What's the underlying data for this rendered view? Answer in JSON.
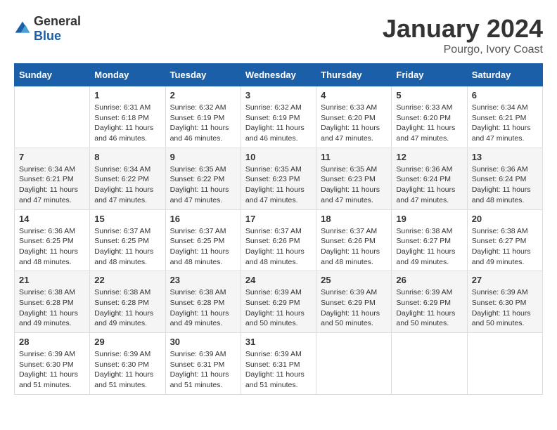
{
  "logo": {
    "general": "General",
    "blue": "Blue"
  },
  "header": {
    "month": "January 2024",
    "location": "Pourgo, Ivory Coast"
  },
  "weekdays": [
    "Sunday",
    "Monday",
    "Tuesday",
    "Wednesday",
    "Thursday",
    "Friday",
    "Saturday"
  ],
  "weeks": [
    [
      {
        "day": "",
        "info": ""
      },
      {
        "day": "1",
        "info": "Sunrise: 6:31 AM\nSunset: 6:18 PM\nDaylight: 11 hours\nand 46 minutes."
      },
      {
        "day": "2",
        "info": "Sunrise: 6:32 AM\nSunset: 6:19 PM\nDaylight: 11 hours\nand 46 minutes."
      },
      {
        "day": "3",
        "info": "Sunrise: 6:32 AM\nSunset: 6:19 PM\nDaylight: 11 hours\nand 46 minutes."
      },
      {
        "day": "4",
        "info": "Sunrise: 6:33 AM\nSunset: 6:20 PM\nDaylight: 11 hours\nand 47 minutes."
      },
      {
        "day": "5",
        "info": "Sunrise: 6:33 AM\nSunset: 6:20 PM\nDaylight: 11 hours\nand 47 minutes."
      },
      {
        "day": "6",
        "info": "Sunrise: 6:34 AM\nSunset: 6:21 PM\nDaylight: 11 hours\nand 47 minutes."
      }
    ],
    [
      {
        "day": "7",
        "info": "Sunrise: 6:34 AM\nSunset: 6:21 PM\nDaylight: 11 hours\nand 47 minutes."
      },
      {
        "day": "8",
        "info": "Sunrise: 6:34 AM\nSunset: 6:22 PM\nDaylight: 11 hours\nand 47 minutes."
      },
      {
        "day": "9",
        "info": "Sunrise: 6:35 AM\nSunset: 6:22 PM\nDaylight: 11 hours\nand 47 minutes."
      },
      {
        "day": "10",
        "info": "Sunrise: 6:35 AM\nSunset: 6:23 PM\nDaylight: 11 hours\nand 47 minutes."
      },
      {
        "day": "11",
        "info": "Sunrise: 6:35 AM\nSunset: 6:23 PM\nDaylight: 11 hours\nand 47 minutes."
      },
      {
        "day": "12",
        "info": "Sunrise: 6:36 AM\nSunset: 6:24 PM\nDaylight: 11 hours\nand 47 minutes."
      },
      {
        "day": "13",
        "info": "Sunrise: 6:36 AM\nSunset: 6:24 PM\nDaylight: 11 hours\nand 48 minutes."
      }
    ],
    [
      {
        "day": "14",
        "info": "Sunrise: 6:36 AM\nSunset: 6:25 PM\nDaylight: 11 hours\nand 48 minutes."
      },
      {
        "day": "15",
        "info": "Sunrise: 6:37 AM\nSunset: 6:25 PM\nDaylight: 11 hours\nand 48 minutes."
      },
      {
        "day": "16",
        "info": "Sunrise: 6:37 AM\nSunset: 6:25 PM\nDaylight: 11 hours\nand 48 minutes."
      },
      {
        "day": "17",
        "info": "Sunrise: 6:37 AM\nSunset: 6:26 PM\nDaylight: 11 hours\nand 48 minutes."
      },
      {
        "day": "18",
        "info": "Sunrise: 6:37 AM\nSunset: 6:26 PM\nDaylight: 11 hours\nand 48 minutes."
      },
      {
        "day": "19",
        "info": "Sunrise: 6:38 AM\nSunset: 6:27 PM\nDaylight: 11 hours\nand 49 minutes."
      },
      {
        "day": "20",
        "info": "Sunrise: 6:38 AM\nSunset: 6:27 PM\nDaylight: 11 hours\nand 49 minutes."
      }
    ],
    [
      {
        "day": "21",
        "info": "Sunrise: 6:38 AM\nSunset: 6:28 PM\nDaylight: 11 hours\nand 49 minutes."
      },
      {
        "day": "22",
        "info": "Sunrise: 6:38 AM\nSunset: 6:28 PM\nDaylight: 11 hours\nand 49 minutes."
      },
      {
        "day": "23",
        "info": "Sunrise: 6:38 AM\nSunset: 6:28 PM\nDaylight: 11 hours\nand 49 minutes."
      },
      {
        "day": "24",
        "info": "Sunrise: 6:39 AM\nSunset: 6:29 PM\nDaylight: 11 hours\nand 50 minutes."
      },
      {
        "day": "25",
        "info": "Sunrise: 6:39 AM\nSunset: 6:29 PM\nDaylight: 11 hours\nand 50 minutes."
      },
      {
        "day": "26",
        "info": "Sunrise: 6:39 AM\nSunset: 6:29 PM\nDaylight: 11 hours\nand 50 minutes."
      },
      {
        "day": "27",
        "info": "Sunrise: 6:39 AM\nSunset: 6:30 PM\nDaylight: 11 hours\nand 50 minutes."
      }
    ],
    [
      {
        "day": "28",
        "info": "Sunrise: 6:39 AM\nSunset: 6:30 PM\nDaylight: 11 hours\nand 51 minutes."
      },
      {
        "day": "29",
        "info": "Sunrise: 6:39 AM\nSunset: 6:30 PM\nDaylight: 11 hours\nand 51 minutes."
      },
      {
        "day": "30",
        "info": "Sunrise: 6:39 AM\nSunset: 6:31 PM\nDaylight: 11 hours\nand 51 minutes."
      },
      {
        "day": "31",
        "info": "Sunrise: 6:39 AM\nSunset: 6:31 PM\nDaylight: 11 hours\nand 51 minutes."
      },
      {
        "day": "",
        "info": ""
      },
      {
        "day": "",
        "info": ""
      },
      {
        "day": "",
        "info": ""
      }
    ]
  ]
}
